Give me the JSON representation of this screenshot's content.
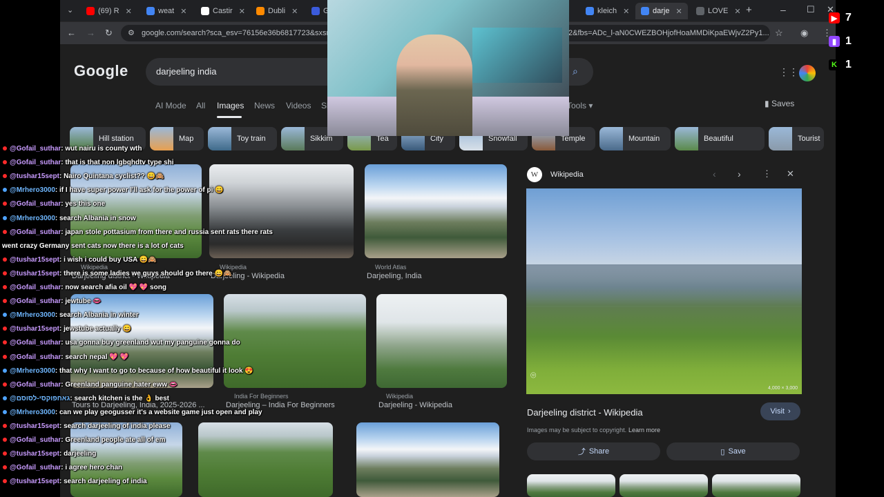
{
  "browser": {
    "tabs": [
      {
        "label": "(69) R",
        "fav": "#ff0000",
        "icon": "youtube-icon"
      },
      {
        "label": "weat",
        "fav": "#4285f4",
        "icon": "google-icon"
      },
      {
        "label": "Castir",
        "fav": "#ffffff",
        "icon": "castr-icon"
      },
      {
        "label": "Dubli",
        "fav": "#ff8a00",
        "icon": "ticket-icon"
      },
      {
        "label": "Ga",
        "fav": "#3b5bdb",
        "icon": "site-icon"
      },
      {
        "label": "kleich",
        "fav": "#4285f4",
        "icon": "google-icon"
      },
      {
        "label": "darje",
        "fav": "#4285f4",
        "icon": "google-icon"
      },
      {
        "label": "LOVE",
        "fav": "#5f6368",
        "icon": "site-icon"
      }
    ],
    "url_start": "google.com/search?sca_esv=76156e36b6817723&sxsrf",
    "url_end": "2&fbs=ADc_l-aN0CWEZBOHjofHoaMMDiKpaEWjvZ2Py1..."
  },
  "google": {
    "logo": "Google",
    "query": "darjeeling india",
    "nav": [
      "AI Mode",
      "All",
      "Images",
      "News",
      "Videos",
      "Sh"
    ],
    "tools": "Tools",
    "saves": "Saves",
    "chips": [
      "Hill station",
      "Map",
      "Toy train",
      "Sikkim",
      "Tea",
      "City",
      "Snowfall",
      "Temple",
      "Mountain",
      "Beautiful",
      "Tourist"
    ]
  },
  "results": [
    {
      "source": "Wikipedia",
      "title": "Darjeeling district - Wikipedia"
    },
    {
      "source": "Wikipedia",
      "title": "Darjeeling - Wikipedia"
    },
    {
      "source": "World Atlas",
      "title": "Darjeeling, India"
    },
    {
      "source": "",
      "title": "Tours to Darjeeling, India, 2025-2026 ..."
    },
    {
      "source": "India For Beginners",
      "title": "Darjeeling – India For Beginners"
    },
    {
      "source": "Wikipedia",
      "title": "Darjeeling - Wikipedia"
    }
  ],
  "panel": {
    "source": "Wikipedia",
    "size": "4,000 × 3,000",
    "title": "Darjeeling district - Wikipedia",
    "visit": "Visit",
    "copyright": "Images may be subject to copyright.",
    "learn_more": "Learn more",
    "share": "Share",
    "save": "Save"
  },
  "counters": {
    "youtube": "7",
    "twitch": "1",
    "kick": "1"
  },
  "chat": [
    {
      "user": "@Gofail_suthar",
      "text": ": wut nairu is county wth",
      "alt": false
    },
    {
      "user": "@Gofail_suthar",
      "text": ": that is that non lgbqhdtv type shi",
      "alt": false
    },
    {
      "user": "@tushar15sept",
      "text": ": Nairo Quintana cyclist?? 😄🙈",
      "alt": false
    },
    {
      "user": "@Mrhero3000",
      "text": ": if I have super power I'll ask for the power of pi 😄",
      "alt": true
    },
    {
      "user": "@Gofail_suthar",
      "text": ": yes this one",
      "alt": false
    },
    {
      "user": "@Mrhero3000",
      "text": ": search Albania in snow",
      "alt": true
    },
    {
      "user": "@Gofail_suthar",
      "text": ": japan stole pottasium from there and russia sent rats there rats",
      "alt": false
    },
    {
      "user": "",
      "text": "went crazy Germany sent cats now there is a lot of cats",
      "alt": false
    },
    {
      "user": "@tushar15sept",
      "text": ": i wish i could buy USA 😄🙈",
      "alt": false
    },
    {
      "user": "@tushar15sept",
      "text": ": there is some ladies we guys should go there 😄🙈",
      "alt": false
    },
    {
      "user": "@Gofail_suthar",
      "text": ": now search afia oil 💖 💖 song",
      "alt": false
    },
    {
      "user": "@Gofail_suthar",
      "text": ": jewtube 👄",
      "alt": false
    },
    {
      "user": "@Mrhero3000",
      "text": ": search Albania in winter",
      "alt": true
    },
    {
      "user": "@tushar15sept",
      "text": ": jewstube actually 😄",
      "alt": false
    },
    {
      "user": "@Gofail_suthar",
      "text": ": usa gonna buy greenland wut my panguine gonna do",
      "alt": false
    },
    {
      "user": "@Gofail_suthar",
      "text": ": search nepal 💖 💖",
      "alt": false
    },
    {
      "user": "@Mrhero3000",
      "text": ": that why I want to go to because of how beautiful it look 😍",
      "alt": true
    },
    {
      "user": "@Gofail_suthar",
      "text": ": Greenland panguine hater eww 👄",
      "alt": false
    },
    {
      "user": "@גאחפוקסי-לסוסם",
      "text": ": search kitchen is the 👌 best",
      "alt": true
    },
    {
      "user": "@Mrhero3000",
      "text": ": can we play geogusser it's a website game just open and play",
      "alt": true
    },
    {
      "user": "@tushar15sept",
      "text": ": search darjeeling of india please",
      "alt": false
    },
    {
      "user": "@Gofail_suthar",
      "text": ": Greenland people ate all of em",
      "alt": false
    },
    {
      "user": "@tushar15sept",
      "text": ": darjeeling",
      "alt": false
    },
    {
      "user": "@Gofail_suthar",
      "text": ": i agree hero chan",
      "alt": false
    },
    {
      "user": "@tushar15sept",
      "text": ": search darjeeling of india",
      "alt": false
    }
  ]
}
